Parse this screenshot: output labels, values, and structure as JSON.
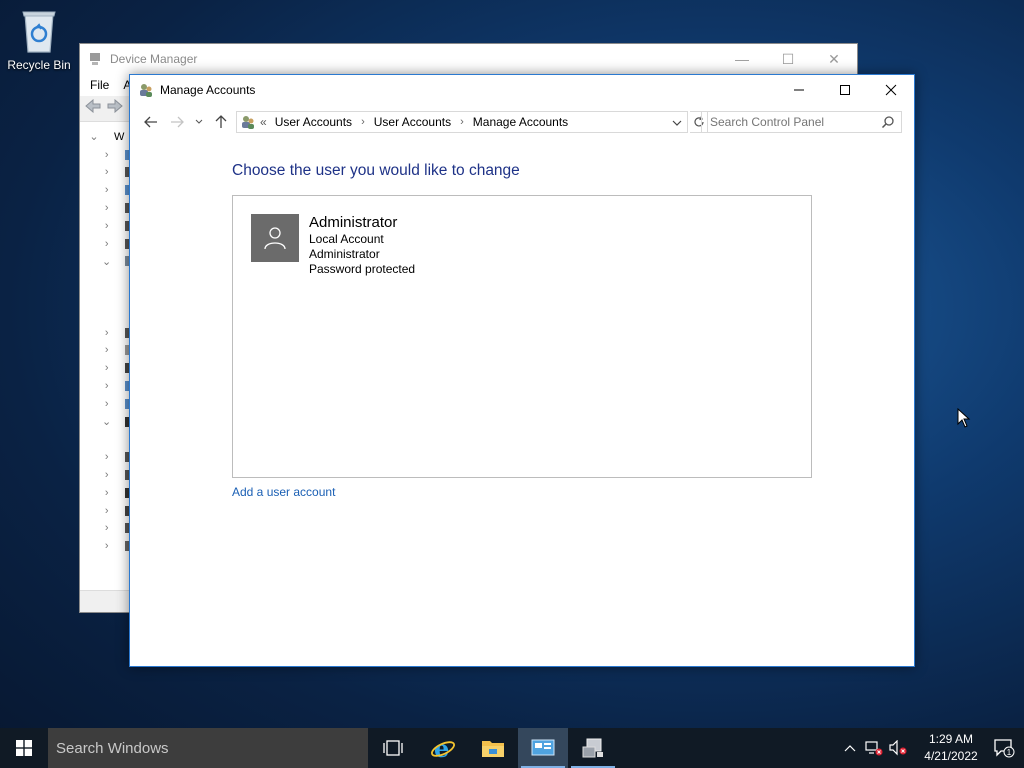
{
  "desktop": {
    "recycle_bin_label": "Recycle Bin"
  },
  "device_manager": {
    "title": "Device Manager",
    "menu": [
      "File",
      "A"
    ],
    "tree_partial_label": "W"
  },
  "manage_accounts": {
    "title": "Manage Accounts",
    "breadcrumb_overflow": "«",
    "breadcrumb": [
      "User Accounts",
      "User Accounts",
      "Manage Accounts"
    ],
    "search_placeholder": "Search Control Panel",
    "heading": "Choose the user you would like to change",
    "account": {
      "name": "Administrator",
      "type": "Local Account",
      "group": "Administrator",
      "status": "Password protected"
    },
    "add_user_link": "Add a user account"
  },
  "taskbar": {
    "search_placeholder": "Search Windows",
    "time": "1:29 AM",
    "date": "4/21/2022",
    "notification_count": "1"
  },
  "colors": {
    "accent": "#2b79d0",
    "heading": "#1e3287",
    "link": "#1a5fb4",
    "taskbar": "#101a25"
  }
}
